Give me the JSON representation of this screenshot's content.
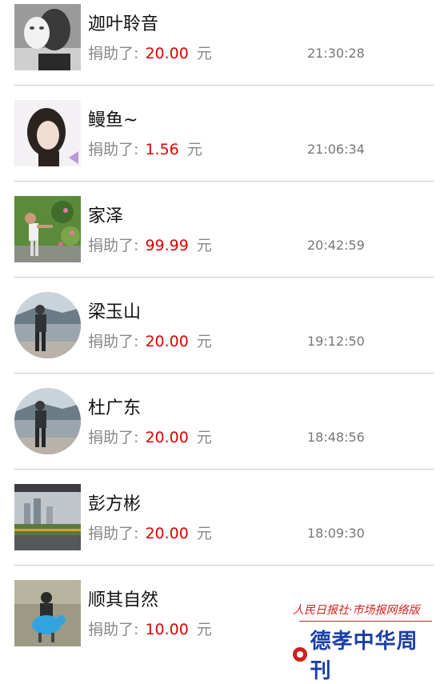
{
  "donations": [
    {
      "name": "迦叶聆音",
      "label": "捐助了:",
      "amount": "20.00",
      "unit": "元",
      "time": "21:30:28",
      "avatar": "masked-man-avatar"
    },
    {
      "name": "鳗鱼~",
      "label": "捐助了:",
      "amount": "1.56",
      "unit": "元",
      "time": "21:06:34",
      "avatar": "girl-portrait-avatar"
    },
    {
      "name": "家泽",
      "label": "捐助了:",
      "amount": "99.99",
      "unit": "元",
      "time": "20:42:59",
      "avatar": "child-flowers-avatar"
    },
    {
      "name": "梁玉山",
      "label": "捐助了:",
      "amount": "20.00",
      "unit": "元",
      "time": "19:12:50",
      "avatar": "man-riverbank-avatar"
    },
    {
      "name": "杜广东",
      "label": "捐助了:",
      "amount": "20.00",
      "unit": "元",
      "time": "18:48:56",
      "avatar": "man-riverbank-avatar"
    },
    {
      "name": "彭方彬",
      "label": "捐助了:",
      "amount": "20.00",
      "unit": "元",
      "time": "18:09:30",
      "avatar": "city-road-avatar"
    },
    {
      "name": "顺其自然",
      "label": "捐助了:",
      "amount": "10.00",
      "unit": "元",
      "time": "",
      "avatar": "child-toy-avatar"
    }
  ],
  "watermark": {
    "top_text": "人民日报社·市场报网络版",
    "brand": "德孝中华周刊"
  },
  "colors": {
    "amount": "#e00000",
    "divider": "#c8c8c8",
    "brand": "#1b3fa8",
    "watermark_red": "#d21f1f"
  }
}
